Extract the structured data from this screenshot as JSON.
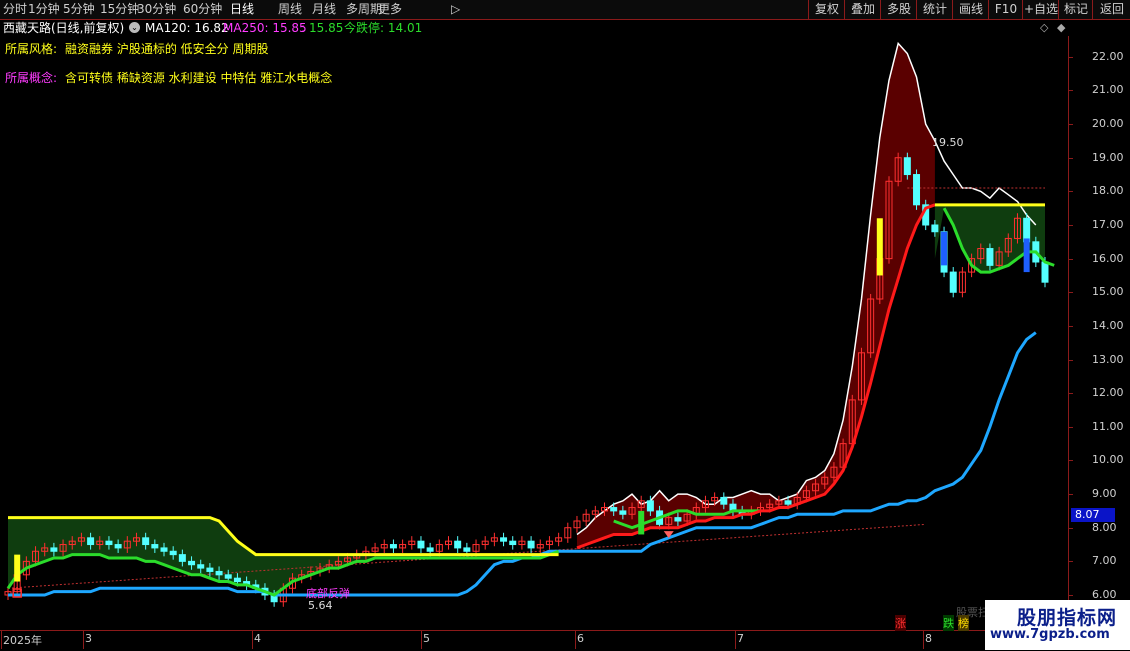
{
  "toolbar": {
    "left_items": [
      "分时",
      "1分钟",
      "5分钟",
      "15分钟",
      "30分钟",
      "60分钟",
      "日线",
      "周线",
      "月线",
      "多周期",
      "更多"
    ],
    "active": "日线",
    "right_items": [
      "复权",
      "叠加",
      "多股",
      "统计",
      "画线",
      "F10",
      "+自选",
      "标记",
      "返回"
    ]
  },
  "info": {
    "title": "西藏天路(日线,前复权)",
    "ma120": "MA120: 16.82",
    "ma250": "MA250: 15.85",
    "sep": ":",
    "ma_extra": "15.85",
    "limit_down": "今跌停: 14.01"
  },
  "style_label": "所属风格:",
  "style_value": "融资融券 沪股通标的 低安全分 周期股",
  "concept_label": "所属概念:",
  "concept_value": "含可转债 稀缺资源 水利建设 中特估 雅江水电概念",
  "colors": {
    "up": "#ff3030",
    "down": "#54ffff",
    "ma_red": "#ff1a1a",
    "ma_green": "#2bdc2b",
    "ma_blue": "#1ea7ff",
    "yellow": "#ffff1a",
    "fill_red": "#5a0000",
    "fill_green": "#0f3d0f",
    "accent_purple": "#ff3cff"
  },
  "annotations": {
    "high": "19.50",
    "low": "5.64",
    "signal": "底部反弹",
    "hidden_label": "股票扫"
  },
  "markers": {
    "zhang": "涨",
    "die": "跌",
    "bang": "榜"
  },
  "last_price": "8.07",
  "watermark": {
    "title": "股朋指标网",
    "url": "www.7gpzb.com"
  },
  "chart_data": {
    "type": "candlestick",
    "x_axis_labels": [
      "2025年",
      "3",
      "4",
      "5",
      "6",
      "7",
      "8"
    ],
    "y_ticks": [
      6.0,
      7.0,
      8.0,
      9.0,
      10.0,
      11.0,
      12.0,
      13.0,
      14.0,
      15.0,
      16.0,
      17.0,
      18.0,
      19.0,
      20.0,
      21.0,
      22.0
    ],
    "ylim": [
      6.0,
      22.5
    ],
    "close_series": [
      6.1,
      6.6,
      7.0,
      7.3,
      7.4,
      7.3,
      7.5,
      7.6,
      7.7,
      7.5,
      7.6,
      7.5,
      7.4,
      7.6,
      7.7,
      7.5,
      7.4,
      7.3,
      7.2,
      7.0,
      6.9,
      6.8,
      6.7,
      6.6,
      6.5,
      6.4,
      6.3,
      6.2,
      6.0,
      5.8,
      6.2,
      6.5,
      6.6,
      6.7,
      6.8,
      6.9,
      7.0,
      7.1,
      7.2,
      7.3,
      7.4,
      7.5,
      7.4,
      7.5,
      7.6,
      7.4,
      7.3,
      7.5,
      7.6,
      7.4,
      7.3,
      7.5,
      7.6,
      7.7,
      7.6,
      7.5,
      7.6,
      7.4,
      7.5,
      7.6,
      7.7,
      8.0,
      8.2,
      8.4,
      8.5,
      8.6,
      8.5,
      8.4,
      8.6,
      8.8,
      8.5,
      8.1,
      8.3,
      8.2,
      8.4,
      8.6,
      8.8,
      8.9,
      8.7,
      8.5,
      8.4,
      8.5,
      8.6,
      8.7,
      8.8,
      8.7,
      8.9,
      9.1,
      9.3,
      9.5,
      9.8,
      10.5,
      11.8,
      13.2,
      14.8,
      16.0,
      18.3,
      19.0,
      18.5,
      17.6,
      17.0,
      16.8,
      15.6,
      15.0,
      15.6,
      16.0,
      16.3,
      15.8,
      16.2,
      16.6,
      17.2,
      16.5,
      15.9,
      15.3
    ],
    "ma_red": [
      null,
      null,
      null,
      null,
      null,
      null,
      null,
      null,
      null,
      null,
      null,
      null,
      null,
      null,
      null,
      null,
      null,
      null,
      null,
      null,
      null,
      null,
      null,
      null,
      null,
      null,
      null,
      null,
      null,
      null,
      null,
      null,
      null,
      null,
      null,
      null,
      null,
      null,
      null,
      null,
      null,
      null,
      null,
      null,
      null,
      null,
      null,
      null,
      null,
      null,
      null,
      null,
      null,
      null,
      null,
      null,
      null,
      null,
      null,
      null,
      null,
      null,
      7.4,
      7.5,
      7.6,
      7.7,
      7.8,
      7.8,
      7.8,
      7.9,
      8.0,
      8.0,
      8.0,
      8.0,
      8.1,
      8.2,
      8.2,
      8.3,
      8.3,
      8.3,
      8.4,
      8.4,
      8.5,
      8.5,
      8.6,
      8.6,
      8.7,
      8.8,
      8.9,
      9.0,
      9.3,
      9.7,
      10.4,
      11.3,
      12.3,
      13.4,
      14.5,
      15.4,
      16.3,
      17.0,
      17.5,
      17.6,
      null,
      null,
      null,
      null,
      null,
      null,
      null,
      null,
      null,
      null,
      null,
      null
    ],
    "ma_green": [
      6.2,
      6.6,
      6.8,
      6.9,
      7.0,
      7.1,
      7.1,
      7.2,
      7.2,
      7.2,
      7.2,
      7.1,
      7.1,
      7.1,
      7.1,
      7.0,
      7.0,
      6.9,
      6.8,
      6.7,
      6.6,
      6.6,
      6.5,
      6.4,
      6.4,
      6.3,
      6.3,
      6.2,
      6.1,
      6.0,
      6.2,
      6.4,
      6.5,
      6.6,
      6.7,
      6.8,
      6.8,
      6.9,
      7.0,
      7.0,
      7.1,
      7.1,
      7.1,
      7.1,
      7.1,
      7.1,
      7.1,
      7.1,
      7.1,
      7.1,
      7.1,
      7.1,
      7.1,
      7.1,
      7.1,
      7.1,
      7.1,
      7.1,
      7.1,
      7.2,
      7.3,
      null,
      null,
      null,
      null,
      null,
      8.2,
      8.1,
      8.0,
      8.1,
      8.2,
      8.3,
      8.4,
      8.5,
      8.5,
      8.4,
      8.4,
      8.4,
      8.4,
      8.5,
      8.5,
      8.5,
      8.5,
      null,
      null,
      null,
      null,
      null,
      null,
      null,
      null,
      null,
      null,
      null,
      null,
      null,
      null,
      null,
      null,
      null,
      null,
      null,
      17.5,
      17.0,
      16.3,
      15.8,
      15.6,
      15.6,
      15.7,
      15.8,
      16.0,
      16.2,
      16.2,
      15.9,
      15.8
    ],
    "ma_blue": [
      6.0,
      6.0,
      6.0,
      6.0,
      6.0,
      6.1,
      6.1,
      6.1,
      6.1,
      6.1,
      6.2,
      6.2,
      6.2,
      6.2,
      6.2,
      6.2,
      6.2,
      6.2,
      6.2,
      6.2,
      6.2,
      6.2,
      6.2,
      6.2,
      6.2,
      6.1,
      6.1,
      6.1,
      6.1,
      6.0,
      6.0,
      6.0,
      6.0,
      6.0,
      6.0,
      6.0,
      6.0,
      6.0,
      6.0,
      6.0,
      6.0,
      6.0,
      6.0,
      6.0,
      6.0,
      6.0,
      6.0,
      6.0,
      6.0,
      6.0,
      6.1,
      6.3,
      6.6,
      6.9,
      7.0,
      7.0,
      7.1,
      7.1,
      7.2,
      7.3,
      7.3,
      7.3,
      7.3,
      7.3,
      7.3,
      7.3,
      7.3,
      7.3,
      7.3,
      7.3,
      7.5,
      7.6,
      7.7,
      7.8,
      7.9,
      8.0,
      8.0,
      8.0,
      8.0,
      8.0,
      8.0,
      8.0,
      8.1,
      8.2,
      8.3,
      8.3,
      8.4,
      8.4,
      8.4,
      8.4,
      8.4,
      8.5,
      8.5,
      8.5,
      8.5,
      8.6,
      8.7,
      8.7,
      8.8,
      8.8,
      8.9,
      9.1,
      9.2,
      9.3,
      9.5,
      9.9,
      10.3,
      11.0,
      11.8,
      12.5,
      13.2,
      13.6,
      13.8
    ],
    "band_top": [
      8.3,
      8.3,
      8.3,
      8.3,
      8.3,
      8.3,
      8.3,
      8.3,
      8.3,
      8.3,
      8.3,
      8.3,
      8.3,
      8.3,
      8.3,
      8.3,
      8.3,
      8.3,
      8.3,
      8.3,
      8.3,
      8.3,
      8.3,
      8.2,
      7.9,
      7.6,
      7.4,
      7.2,
      7.2,
      7.2,
      7.2,
      7.2,
      7.2,
      7.2,
      7.2,
      7.2,
      7.2,
      7.2,
      7.2,
      7.2,
      7.2,
      7.2,
      7.2,
      7.2,
      7.2,
      7.2,
      7.2,
      7.2,
      7.2,
      7.2,
      7.2,
      7.2,
      7.2,
      7.2,
      7.2,
      7.2,
      7.2,
      7.2,
      7.2,
      7.2,
      7.2
    ],
    "yellow_band2": [
      17.6,
      17.6,
      17.6,
      17.6,
      17.6,
      17.6,
      17.6,
      17.6,
      17.6,
      17.6,
      17.6,
      17.6,
      17.6
    ],
    "envelope_top": [
      null,
      null,
      null,
      null,
      null,
      null,
      null,
      null,
      null,
      null,
      null,
      null,
      null,
      null,
      null,
      null,
      null,
      null,
      null,
      null,
      null,
      null,
      null,
      null,
      null,
      null,
      null,
      null,
      null,
      null,
      null,
      null,
      null,
      null,
      null,
      null,
      null,
      null,
      null,
      null,
      null,
      null,
      null,
      null,
      null,
      null,
      null,
      null,
      null,
      null,
      null,
      null,
      null,
      null,
      null,
      null,
      null,
      null,
      null,
      null,
      null,
      null,
      7.8,
      8.0,
      8.3,
      8.5,
      8.7,
      8.8,
      9.0,
      8.7,
      8.8,
      9.1,
      8.8,
      9.0,
      9.0,
      8.9,
      8.7,
      8.7,
      8.9,
      8.9,
      9.0,
      9.1,
      9.0,
      9.0,
      8.8,
      8.9,
      9.0,
      9.4,
      9.5,
      9.7,
      10.2,
      11.2,
      12.8,
      14.8,
      17.3,
      19.6,
      21.3,
      22.4,
      22.1,
      21.4,
      20.0,
      19.5,
      18.9,
      18.5,
      18.1,
      18.1,
      18.0,
      17.8,
      18.1,
      17.9,
      17.7,
      17.3,
      17.0,
      null
    ]
  }
}
